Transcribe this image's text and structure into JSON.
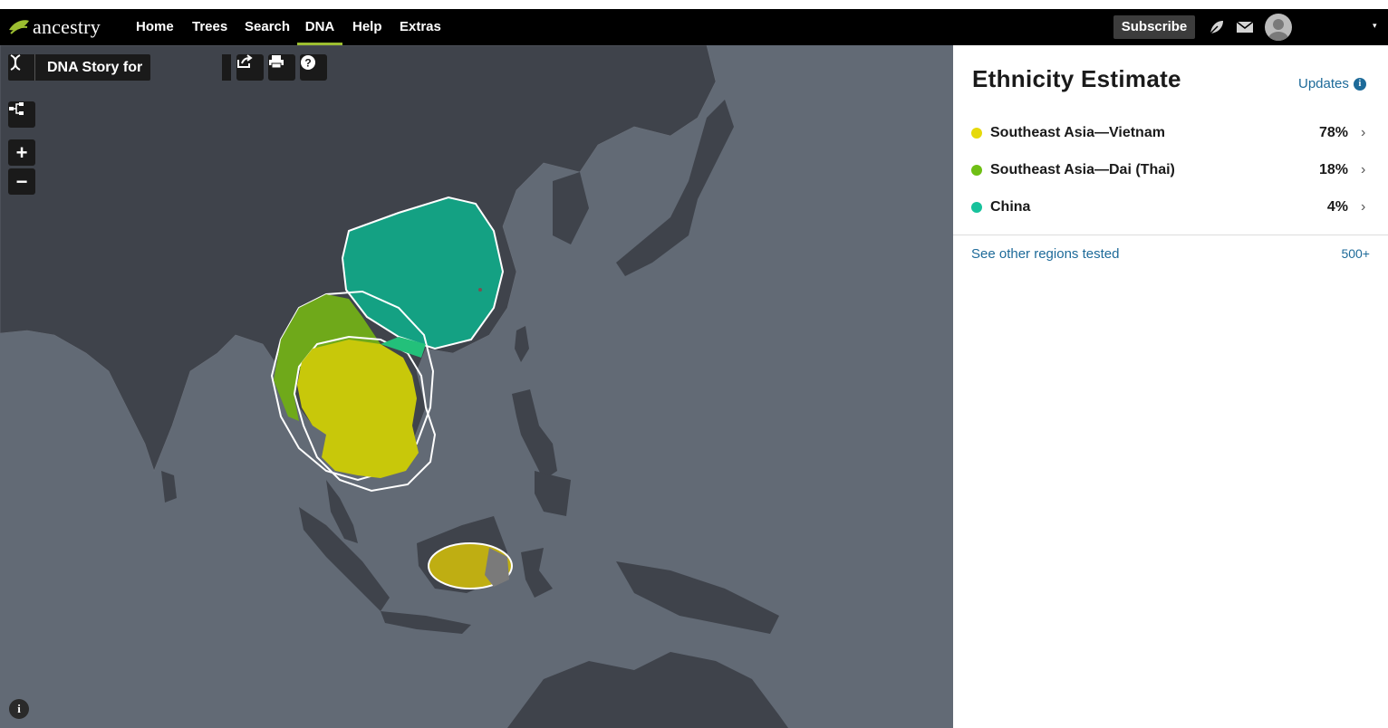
{
  "header": {
    "brand": "ancestry",
    "nav": [
      {
        "label": "Home"
      },
      {
        "label": "Trees"
      },
      {
        "label": "Search"
      },
      {
        "label": "DNA"
      },
      {
        "label": "Help"
      },
      {
        "label": "Extras"
      }
    ],
    "active_nav": "DNA",
    "subscribe_label": "Subscribe",
    "icons": [
      "hint-leaf-icon",
      "mail-icon",
      "avatar"
    ]
  },
  "map_toolbar": {
    "title": "DNA Story for",
    "buttons": [
      "share-icon",
      "print-icon",
      "help-icon"
    ],
    "controls": [
      "tree-icon",
      "zoom-in",
      "zoom-out"
    ],
    "zoom_in_label": "+",
    "zoom_out_label": "−",
    "info_label": "i"
  },
  "panel": {
    "title": "Ethnicity Estimate",
    "updates_label": "Updates",
    "regions": [
      {
        "name": "Southeast Asia—Vietnam",
        "percent": "78%",
        "color": "#e6d90b"
      },
      {
        "name": "Southeast Asia—Dai (Thai)",
        "percent": "18%",
        "color": "#6fbf14"
      },
      {
        "name": "China",
        "percent": "4%",
        "color": "#17c29c"
      }
    ],
    "other_regions_label": "See other regions tested",
    "other_regions_count": "500+"
  },
  "colors": {
    "nav_bg": "#000000",
    "map_sea": "#626a75",
    "map_land": "#3f434b",
    "link": "#1d6a99",
    "accent_underline": "#9cbe30"
  }
}
